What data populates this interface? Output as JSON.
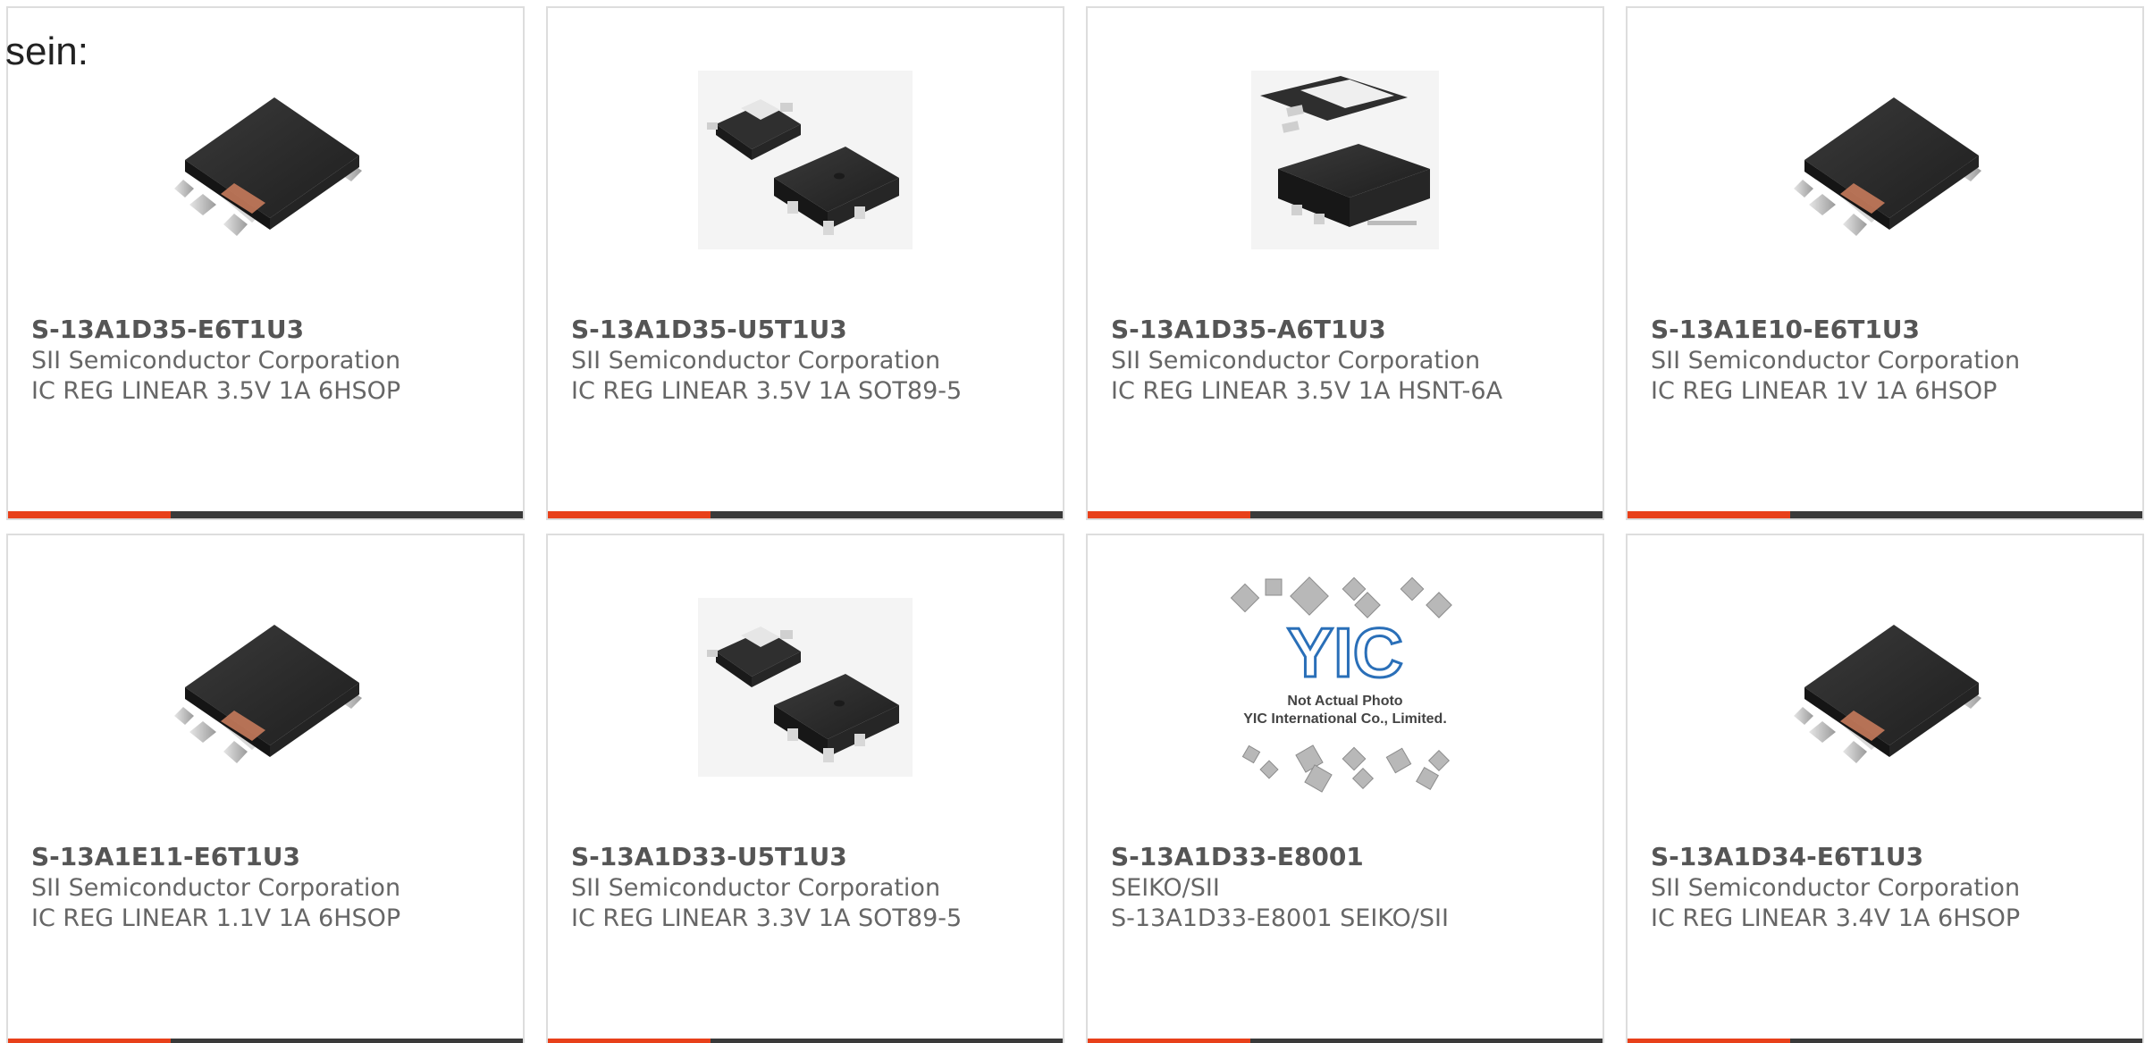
{
  "intro_text": "sein:",
  "colors": {
    "accent": "#e8401a",
    "bar": "#3a3a3a",
    "border": "#dddddd",
    "text": "#666666",
    "package": "#2b2b2b"
  },
  "products": [
    {
      "part_number": "S-13A1D35-E6T1U3",
      "manufacturer": "SII Semiconductor Corporation",
      "description": "IC REG LINEAR 3.5V 1A 6HSOP",
      "image": "hsop-package"
    },
    {
      "part_number": "S-13A1D35-U5T1U3",
      "manufacturer": "SII Semiconductor Corporation",
      "description": "IC REG LINEAR 3.5V 1A SOT89-5",
      "image": "sot89-package"
    },
    {
      "part_number": "S-13A1D35-A6T1U3",
      "manufacturer": "SII Semiconductor Corporation",
      "description": "IC REG LINEAR 3.5V 1A HSNT-6A",
      "image": "hsnt-package"
    },
    {
      "part_number": "S-13A1E10-E6T1U3",
      "manufacturer": "SII Semiconductor Corporation",
      "description": "IC REG LINEAR 1V 1A 6HSOP",
      "image": "hsop-package"
    },
    {
      "part_number": "S-13A1E11-E6T1U3",
      "manufacturer": "SII Semiconductor Corporation",
      "description": "IC REG LINEAR 1.1V 1A 6HSOP",
      "image": "hsop-package"
    },
    {
      "part_number": "S-13A1D33-U5T1U3",
      "manufacturer": "SII Semiconductor Corporation",
      "description": "IC REG LINEAR 3.3V 1A SOT89-5",
      "image": "sot89-package"
    },
    {
      "part_number": "S-13A1D33-E8001",
      "manufacturer": "SEIKO/SII",
      "description": "S-13A1D33-E8001 SEIKO/SII",
      "image": "not-actual-photo",
      "image_caption_1": "Not Actual Photo",
      "image_caption_2": "YIC International Co., Limited.",
      "image_logo": "YIC"
    },
    {
      "part_number": "S-13A1D34-E6T1U3",
      "manufacturer": "SII Semiconductor Corporation",
      "description": "IC REG LINEAR 3.4V 1A 6HSOP",
      "image": "hsop-package"
    }
  ]
}
